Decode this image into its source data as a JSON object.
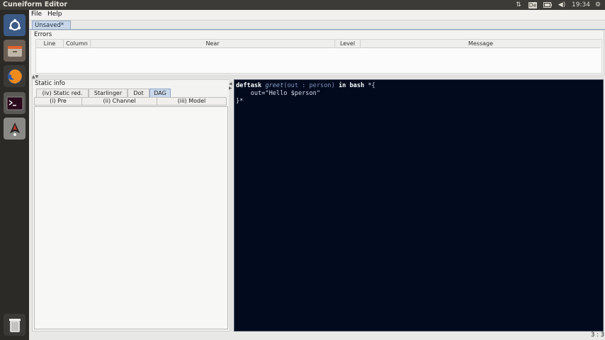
{
  "window": {
    "title": "Cuneiform Editor"
  },
  "tray": {
    "keyboard_layout": "De",
    "clock": "19:34"
  },
  "menu": {
    "file": "File",
    "help": "Help"
  },
  "document_tab": {
    "label": "Unsaved*"
  },
  "errors": {
    "title": "Errors",
    "columns": [
      "Line",
      "Column",
      "Near",
      "Level",
      "Message"
    ]
  },
  "static_info": {
    "title": "Static info",
    "tabs": [
      "(iv) Static red.",
      "Starlinger",
      "Dot",
      "DAG"
    ],
    "selected_tab": "DAG",
    "subtabs": [
      "(i) Pre",
      "(ii) Channel",
      "(iii) Model"
    ]
  },
  "editor": {
    "line1": {
      "kw_deftask": "deftask",
      "fn_name": "greet",
      "paren_open": "(",
      "param": "out : person",
      "paren_close": ")",
      "kw_in": "in",
      "kw_bash": "bash",
      "brace": "*{"
    },
    "line2": "    out=\"Hello $person\"",
    "line3": "}*"
  },
  "status": {
    "cursor": "3 : 3"
  },
  "icons": [
    "ubuntu-dash-icon",
    "files-icon",
    "firefox-icon",
    "terminal-icon",
    "java-app-icon",
    "trash-icon"
  ]
}
